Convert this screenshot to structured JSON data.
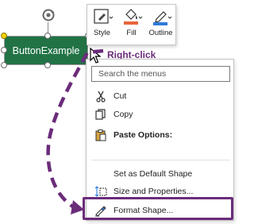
{
  "shape": {
    "label": "ButtonExample"
  },
  "mini_toolbar": {
    "items": [
      {
        "label": "Style",
        "icon": "style-icon"
      },
      {
        "label": "Fill",
        "icon": "fill-icon"
      },
      {
        "label": "Outline",
        "icon": "outline-icon"
      }
    ]
  },
  "annotation": {
    "right_click_label": "Right-click",
    "color": "#6b2c7a"
  },
  "context_menu": {
    "search_placeholder": "Search the menus",
    "items": [
      {
        "label": "Cut",
        "icon": "scissors-icon"
      },
      {
        "label": "Copy",
        "icon": "copy-icon"
      },
      {
        "label": "Paste Options:",
        "icon": "clipboard-icon"
      },
      {
        "label": "Set as Default Shape",
        "icon": ""
      },
      {
        "label": "Size and Properties...",
        "icon": "size-properties-icon"
      },
      {
        "label": "Format Shape...",
        "icon": "format-shape-icon"
      }
    ]
  },
  "colors": {
    "shape_fill": "#217346",
    "highlight": "#6b2c7a",
    "fill_accent": "#e8643a",
    "outline_accent": "#2f7bd8"
  }
}
